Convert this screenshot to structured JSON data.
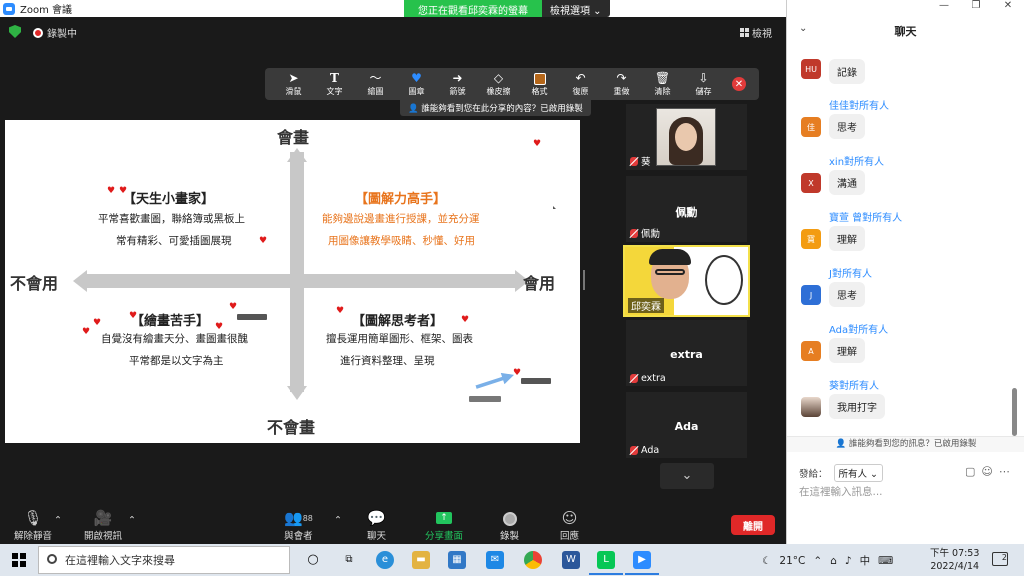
{
  "window": {
    "title": "Zoom 會議"
  },
  "share_banner": {
    "status": "您正在觀看邱奕霖的螢幕",
    "view_options": "檢視選項"
  },
  "topbar": {
    "recording": "錄製中",
    "view": "檢視"
  },
  "annotation_toolbar": {
    "tools": [
      {
        "label": "滑鼠",
        "icon": "pointer-icon"
      },
      {
        "label": "文字",
        "icon": "text-icon"
      },
      {
        "label": "繪圖",
        "icon": "draw-icon"
      },
      {
        "label": "圖章",
        "icon": "stamp-icon"
      },
      {
        "label": "箭號",
        "icon": "arrow-icon"
      },
      {
        "label": "橡皮擦",
        "icon": "eraser-icon"
      },
      {
        "label": "格式",
        "icon": "format-icon"
      },
      {
        "label": "復原",
        "icon": "undo-icon"
      },
      {
        "label": "重做",
        "icon": "redo-icon"
      },
      {
        "label": "清除",
        "icon": "trash-icon"
      },
      {
        "label": "儲存",
        "icon": "save-icon"
      }
    ],
    "active_tool": "圖章",
    "who_sees": "誰能夠看到您在此分享的內容？已啟用錄製"
  },
  "slide": {
    "axis_top": "會畫",
    "axis_bottom": "不會畫",
    "axis_left": "不會用",
    "axis_right": "會用",
    "q_topleft": {
      "title": "【天生小畫家】",
      "lines": [
        "平常喜歡畫圖，聯絡簿或黑板上",
        "常有精彩、可愛插圖展現"
      ]
    },
    "q_topright": {
      "title": "【圖解力高手】",
      "lines": [
        "能夠邊說邊畫進行授課，並充分運",
        "用圖像讓教學吸睛、秒懂、好用"
      ]
    },
    "q_bottomleft": {
      "title": "【繪畫苦手】",
      "lines": [
        "自覺沒有繪畫天分、畫圖畫很醜",
        "平常都是以文字為主"
      ]
    },
    "q_bottomright": {
      "title": "【圖解思考者】",
      "lines": [
        "擅長運用簡單圖形、框架、圖表",
        "進行資料整理、呈現"
      ]
    }
  },
  "gallery": {
    "tiles": [
      {
        "name": "葵",
        "muted": true
      },
      {
        "name": "佩勳",
        "display": "佩勳",
        "muted": true
      },
      {
        "name": "邱奕霖",
        "muted": false
      },
      {
        "name": "extra",
        "display": "extra",
        "muted": true
      },
      {
        "name": "Ada",
        "display": "Ada",
        "muted": true
      }
    ]
  },
  "controls": {
    "unmute": "解除靜音",
    "start_video": "開啟視訊",
    "participants": "與會者",
    "participant_count": "88",
    "chat": "聊天",
    "share_screen": "分享畫面",
    "record": "錄製",
    "reactions": "回應",
    "end": "離開"
  },
  "chat": {
    "title": "聊天",
    "messages": [
      {
        "avatar": "HU",
        "color": "#c0392b",
        "sender": "",
        "text": "記錄"
      },
      {
        "avatar": "佳",
        "color": "#e67e22",
        "sender": "佳佳對所有人",
        "text": "思考"
      },
      {
        "avatar": "X",
        "color": "#c0392b",
        "sender": "xin對所有人",
        "text": "溝通"
      },
      {
        "avatar": "寶",
        "color": "#f39c12",
        "sender": "寶萱 曾對所有人",
        "text": "理解"
      },
      {
        "avatar": "J",
        "color": "#2e6fd6",
        "sender": "J對所有人",
        "text": "思考"
      },
      {
        "avatar": "A",
        "color": "#e67e22",
        "sender": "Ada對所有人",
        "text": "理解"
      },
      {
        "avatar": "",
        "color": "#cccccc",
        "sender": "葵對所有人",
        "text": "我用打字"
      }
    ],
    "notice": "誰能夠看到您的訊息？已啟用錄製",
    "to_label": "發給：",
    "to_value": "所有人",
    "input_placeholder": "在這裡輸入訊息..."
  },
  "taskbar": {
    "search_placeholder": "在這裡輸入文字來搜尋",
    "temperature": "21°C",
    "ime": "中",
    "time": "下午 07:53",
    "date": "2022/4/14",
    "notifications": "2"
  }
}
